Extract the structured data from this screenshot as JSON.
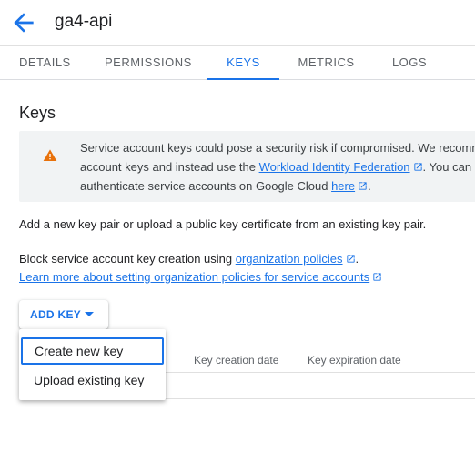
{
  "header": {
    "title": "ga4-api"
  },
  "tabs": [
    {
      "label": "DETAILS"
    },
    {
      "label": "PERMISSIONS"
    },
    {
      "label": "KEYS"
    },
    {
      "label": "METRICS"
    },
    {
      "label": "LOGS"
    }
  ],
  "active_tab": "KEYS",
  "section": {
    "heading": "Keys"
  },
  "warning": {
    "line1": "Service account keys could pose a security risk if compromised. We recomm",
    "line2_prefix": "account keys and instead use the ",
    "line2_link": "Workload Identity Federation",
    "line2_suffix": ". You can l",
    "line3_prefix": "authenticate service accounts on Google Cloud ",
    "line3_link": "here",
    "line3_suffix": "."
  },
  "description": "Add a new key pair or upload a public key certificate from an existing key pair.",
  "policy": {
    "prefix": "Block service account key creation using ",
    "link": "organization policies",
    "suffix": ".",
    "learn_more": "Learn more about setting organization policies for service accounts"
  },
  "add_key_button": {
    "label": "ADD KEY"
  },
  "menu": {
    "items": [
      {
        "label": "Create new key"
      },
      {
        "label": "Upload existing key"
      }
    ]
  },
  "table": {
    "columns": [
      "Key creation date",
      "Key expiration date"
    ]
  },
  "colors": {
    "accent": "#1a73e8",
    "warning": "#e8710a"
  },
  "icons": {
    "back": "arrow-back-icon",
    "warning": "warning-triangle-icon",
    "external": "open-in-new-icon",
    "dropdown": "caret-down-icon"
  }
}
